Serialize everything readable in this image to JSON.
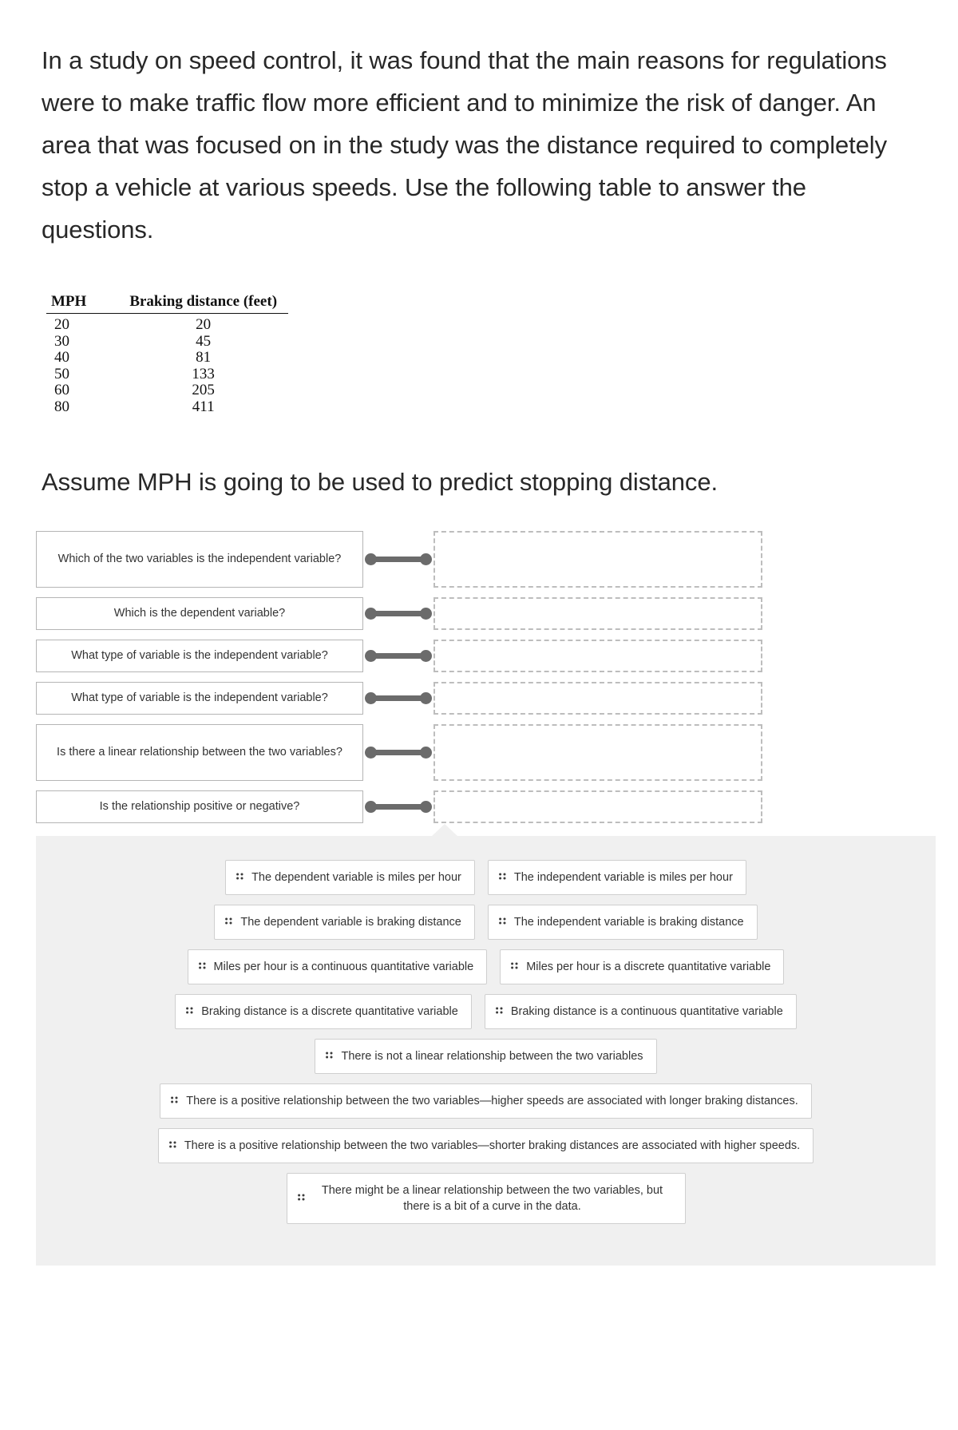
{
  "prompt": {
    "paragraph1": "In a study on speed control, it was found that the main reasons for regulations were to make traffic flow more efficient and to minimize the risk of danger. An area that was focused on in the study was the distance required to completely stop a vehicle at various speeds. Use the following table to answer the questions.",
    "paragraph2": "Assume MPH is going to be used to predict stopping distance."
  },
  "table": {
    "headers": [
      "MPH",
      "Braking distance (feet)"
    ],
    "rows": [
      [
        "20",
        "20"
      ],
      [
        "30",
        "45"
      ],
      [
        "40",
        "81"
      ],
      [
        "50",
        "133"
      ],
      [
        "60",
        "205"
      ],
      [
        "80",
        "411"
      ]
    ]
  },
  "matching": {
    "questions": [
      {
        "text": "Which of the two variables is the independent variable?",
        "tall": true
      },
      {
        "text": "Which is the dependent variable?",
        "tall": false
      },
      {
        "text": "What type of variable is the independent variable?",
        "tall": false
      },
      {
        "text": "What type of variable is the independent variable?",
        "tall": false
      },
      {
        "text": "Is there a linear relationship between the two variables?",
        "tall": true
      },
      {
        "text": "Is the relationship positive or negative?",
        "tall": false
      }
    ],
    "answers_placeholder": ""
  },
  "answer_bank": {
    "rows": [
      [
        "The dependent variable is miles per hour",
        "The independent variable is miles per hour"
      ],
      [
        "The dependent variable is braking distance",
        "The independent variable is braking distance"
      ],
      [
        "Miles per hour is a continuous quantitative variable",
        "Miles per hour is a discrete quantitative variable"
      ],
      [
        "Braking distance is a discrete quantitative variable",
        "Braking distance is a continuous quantitative variable"
      ],
      [
        "There is not a linear relationship between the two variables"
      ],
      [
        "There is a positive relationship between the two variables—higher speeds are associated with longer braking distances."
      ],
      [
        "There is a positive relationship between the two variables—shorter braking distances are associated with higher speeds."
      ],
      [
        "There might be a linear relationship between the two variables, but there is a bit of a curve in the data."
      ]
    ]
  },
  "icons": {
    "drag_handle": "drag-handle-icon"
  },
  "colors": {
    "connector": "#6b6b6b",
    "bank_background": "#f0f0f0",
    "box_border": "#b5b5b5",
    "drop_border": "#bdbdbd"
  }
}
